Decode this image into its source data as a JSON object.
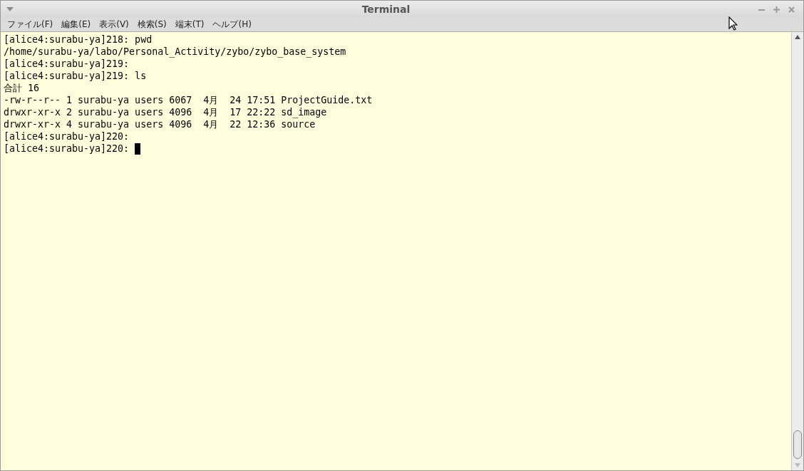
{
  "window": {
    "title": "Terminal"
  },
  "menu": [
    "ファイル(F)",
    "編集(E)",
    "表示(V)",
    "検索(S)",
    "端末(T)",
    "ヘルプ(H)"
  ],
  "terminal": {
    "lines": [
      "[alice4:surabu-ya]218: pwd",
      "/home/surabu-ya/labo/Personal_Activity/zybo/zybo_base_system",
      "[alice4:surabu-ya]219:",
      "[alice4:surabu-ya]219: ls",
      "合計 16",
      "-rw-r--r-- 1 surabu-ya users 6067  4月  24 17:51 ProjectGuide.txt",
      "drwxr-xr-x 2 surabu-ya users 4096  4月  17 22:22 sd_image",
      "drwxr-xr-x 4 surabu-ya users 4096  4月  22 12:36 source",
      "[alice4:surabu-ya]220:",
      "[alice4:surabu-ya]220: "
    ]
  }
}
